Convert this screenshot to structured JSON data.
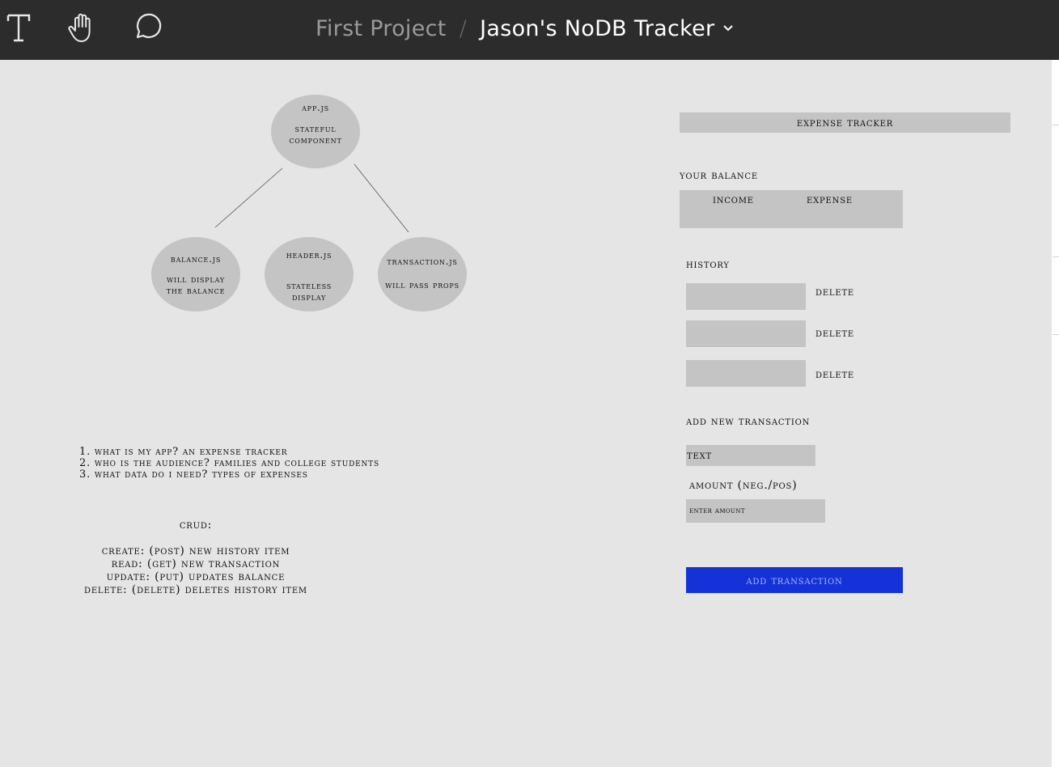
{
  "toolbar": {
    "tools": [
      {
        "icon": "text-tool-icon"
      },
      {
        "icon": "hand-tool-icon"
      },
      {
        "icon": "comment-icon"
      }
    ]
  },
  "breadcrumb": {
    "project": "First Project",
    "separator": "/",
    "file": "Jason's NoDB Tracker",
    "dropdown_icon": "chevron-down-icon"
  },
  "diagram": {
    "root": {
      "title": "App.js",
      "subtitle1": "Stateful",
      "subtitle2": "component"
    },
    "children": [
      {
        "title": "balance.js",
        "line1": "will display",
        "line2": "the balance"
      },
      {
        "title": "Header.js",
        "line1": "Stateless",
        "line2": "display"
      },
      {
        "title": "transaction.js",
        "line1": "will pass props",
        "line2": ""
      }
    ]
  },
  "questions": [
    "1. What is my app? An expense tracker",
    "2. Who is the audience? Families and college students",
    "3. What data do I need? Types of expenses"
  ],
  "crud": {
    "title": "CRUD:",
    "lines": [
      "Create: (POST) new history item",
      "Read: (GET) new transaction",
      "Update: (PUT) updates balance",
      "Delete: (DELETE) deletes history item"
    ]
  },
  "mockup": {
    "header": "Expense Tracker",
    "balance_label": "Your Balance",
    "income_label": "Income",
    "expense_label": "Expense",
    "history_label": "History",
    "history_items": [
      {
        "delete_label": "Delete"
      },
      {
        "delete_label": "Delete"
      },
      {
        "delete_label": "Delete"
      }
    ],
    "add_title": "Add New Transaction",
    "text_field": "Text",
    "amount_label": "Amount (neg./pos)",
    "amount_placeholder": "enter amount",
    "add_button": "Add Transaction"
  },
  "colors": {
    "topbar": "#2c2c2c",
    "canvas": "#e5e5e5",
    "shape_gray": "#c4c4c4",
    "button_blue": "#1432d8"
  }
}
